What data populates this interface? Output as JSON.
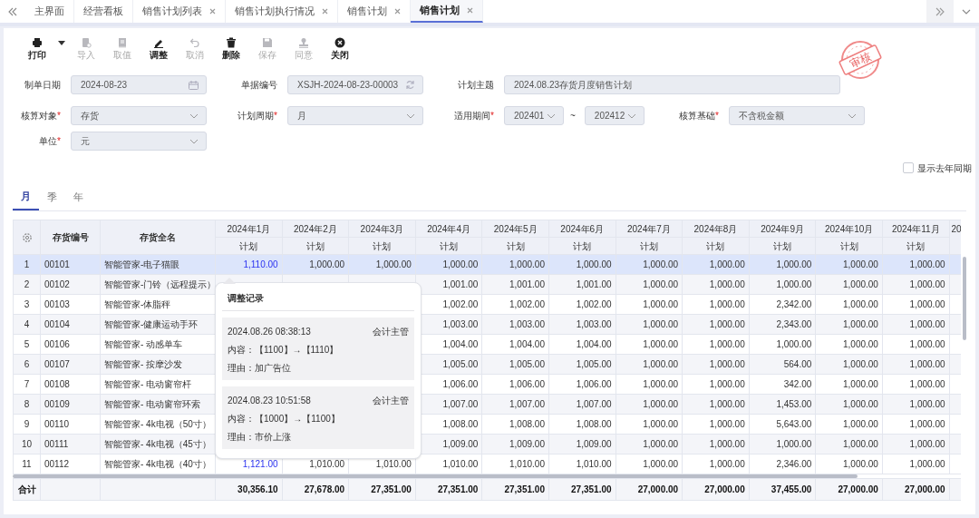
{
  "tab_bar": {
    "tabs": [
      {
        "label": "主界面",
        "closable": false,
        "selected": false
      },
      {
        "label": "经营看板",
        "closable": false,
        "selected": false
      },
      {
        "label": "销售计划列表",
        "closable": true,
        "selected": false
      },
      {
        "label": "销售计划执行情况",
        "closable": true,
        "selected": false
      },
      {
        "label": "销售计划",
        "closable": true,
        "selected": false
      },
      {
        "label": "销售计划",
        "closable": true,
        "selected": true
      }
    ]
  },
  "toolbar": [
    {
      "kind": "print",
      "label": "打印",
      "disabled": false,
      "dropdown": true
    },
    {
      "kind": "import",
      "label": "导入",
      "disabled": true,
      "dropdown": false
    },
    {
      "kind": "fetch",
      "label": "取值",
      "disabled": true,
      "dropdown": false
    },
    {
      "kind": "adjust",
      "label": "调整",
      "disabled": false,
      "dropdown": false
    },
    {
      "kind": "cancel",
      "label": "取消",
      "disabled": true,
      "dropdown": false
    },
    {
      "kind": "delete",
      "label": "删除",
      "disabled": false,
      "dropdown": false
    },
    {
      "kind": "save",
      "label": "保存",
      "disabled": true,
      "dropdown": false
    },
    {
      "kind": "approve",
      "label": "同意",
      "disabled": true,
      "dropdown": false
    },
    {
      "kind": "close",
      "label": "关闭",
      "disabled": false,
      "dropdown": false
    }
  ],
  "stamp": {
    "text": "审核"
  },
  "form": {
    "rows": [
      [
        {
          "kind": "date",
          "label": "制单日期",
          "value": "2024-08-23"
        },
        {
          "kind": "code",
          "label": "单据编号",
          "value": "XSJH-2024-08-23-00003"
        },
        {
          "kind": "text",
          "label": "计划主题",
          "value": "2024.08.23存货月度销售计划"
        }
      ],
      [
        {
          "kind": "select",
          "label": "核算对象",
          "required_mark": "*",
          "value": "存货"
        },
        {
          "kind": "select",
          "label": "计划周期",
          "required_mark": "*",
          "value": "月"
        },
        {
          "kind": "range",
          "label": "适用期间",
          "required_mark": "*",
          "from": "202401",
          "separator": "~",
          "to": "202412"
        },
        {
          "kind": "select",
          "label": "核算基础",
          "required_mark": "*",
          "value": "不含税金额"
        }
      ],
      [
        {
          "kind": "select",
          "label": "单位",
          "required_mark": "*",
          "value": "元"
        }
      ]
    ]
  },
  "show_last_year": {
    "label": "显示去年同期",
    "checked": false
  },
  "period_tabs": [
    {
      "label": "月",
      "selected": true
    },
    {
      "label": "季",
      "selected": false
    },
    {
      "label": "年",
      "selected": false
    }
  ],
  "table": {
    "columns": [
      {
        "label": "存货编号"
      },
      {
        "label": "存货全名"
      }
    ],
    "month_columns": [
      {
        "label": "2024年1月",
        "sub": "计划"
      },
      {
        "label": "2024年2月",
        "sub": "计划"
      },
      {
        "label": "2024年3月",
        "sub": "计划"
      },
      {
        "label": "2024年4月",
        "sub": "计划"
      },
      {
        "label": "2024年5月",
        "sub": "计划"
      },
      {
        "label": "2024年6月",
        "sub": "计划"
      },
      {
        "label": "2024年7月",
        "sub": "计划"
      },
      {
        "label": "2024年8月",
        "sub": "计划"
      },
      {
        "label": "2024年9月",
        "sub": "计划"
      },
      {
        "label": "2024年10月",
        "sub": "计划"
      },
      {
        "label": "2024年11月",
        "sub": "计划"
      },
      {
        "label": "20"
      }
    ],
    "rows": [
      {
        "index": "1",
        "code": "00101",
        "name": "智能管家-电子猫眼",
        "selected": true,
        "cells": [
          {
            "text": "1,110.00",
            "adjusted": true
          },
          "1,000.00",
          "1,000.00",
          "1,000.00",
          "1,000.00",
          "1,000.00",
          "1,000.00",
          "1,000.00",
          "1,000.00",
          "1,000.00",
          "1,000.00"
        ]
      },
      {
        "index": "2",
        "code": "00102",
        "name": "智能管家-门铃（远程提示）",
        "selected": false,
        "cells": [
          null,
          null,
          null,
          "1,001.00",
          "1,001.00",
          "1,001.00",
          "1,000.00",
          "1,000.00",
          "1,000.00",
          "1,000.00",
          "1,000.00"
        ]
      },
      {
        "index": "3",
        "code": "00103",
        "name": "智能管家-体脂秤",
        "selected": false,
        "cells": [
          null,
          null,
          null,
          "1,002.00",
          "1,002.00",
          "1,002.00",
          "1,000.00",
          "1,000.00",
          "2,342.00",
          "1,000.00",
          "1,000.00"
        ]
      },
      {
        "index": "4",
        "code": "00104",
        "name": "智能管家-健康运动手环",
        "selected": false,
        "cells": [
          null,
          null,
          null,
          "1,003.00",
          "1,003.00",
          "1,003.00",
          "1,000.00",
          "1,000.00",
          "2,343.00",
          "1,000.00",
          "1,000.00"
        ]
      },
      {
        "index": "5",
        "code": "00106",
        "name": "智能管家- 动感单车",
        "selected": false,
        "cells": [
          null,
          null,
          null,
          "1,004.00",
          "1,004.00",
          "1,004.00",
          "1,000.00",
          "1,000.00",
          "1,000.00",
          "1,000.00",
          "1,000.00"
        ]
      },
      {
        "index": "6",
        "code": "00107",
        "name": "智能管家- 按摩沙发",
        "selected": false,
        "cells": [
          null,
          null,
          null,
          "1,005.00",
          "1,005.00",
          "1,005.00",
          "1,000.00",
          "1,000.00",
          "564.00",
          "1,000.00",
          "1,000.00"
        ]
      },
      {
        "index": "7",
        "code": "00108",
        "name": "智能管家- 电动窗帘杆",
        "selected": false,
        "cells": [
          null,
          null,
          null,
          "1,006.00",
          "1,006.00",
          "1,006.00",
          "1,000.00",
          "1,000.00",
          "342.00",
          "1,000.00",
          "1,000.00"
        ]
      },
      {
        "index": "8",
        "code": "00109",
        "name": "智能管家- 电动窗帘环索",
        "selected": false,
        "cells": [
          null,
          null,
          null,
          "1,007.00",
          "1,007.00",
          "1,007.00",
          "1,000.00",
          "1,000.00",
          "1,453.00",
          "1,000.00",
          "1,000.00"
        ]
      },
      {
        "index": "9",
        "code": "00110",
        "name": "智能管家- 4k电视（50寸）",
        "selected": false,
        "cells": [
          null,
          null,
          null,
          "1,008.00",
          "1,008.00",
          "1,008.00",
          "1,000.00",
          "1,000.00",
          "5,643.00",
          "1,000.00",
          "1,000.00"
        ]
      },
      {
        "index": "10",
        "code": "00111",
        "name": "智能管家- 4k电视（45寸）",
        "selected": false,
        "cells": [
          null,
          null,
          null,
          "1,009.00",
          "1,009.00",
          "1,009.00",
          "1,000.00",
          "1,000.00",
          "1,000.00",
          "1,000.00",
          "1,000.00"
        ]
      },
      {
        "index": "11",
        "code": "00112",
        "name": "智能管家- 4k电视（40寸）",
        "selected": false,
        "cells": [
          {
            "text": "1,121.00",
            "adjusted": true
          },
          "1,010.00",
          "1,010.00",
          "1,010.00",
          "1,010.00",
          "1,010.00",
          "1,000.00",
          "1,000.00",
          "2,346.00",
          "1,000.00",
          "1,000.00"
        ]
      }
    ],
    "total": {
      "label": "合计",
      "cells": [
        "30,356.10",
        "27,678.00",
        "27,351.00",
        "27,351.00",
        "27,351.00",
        "27,351.00",
        "27,000.00",
        "27,000.00",
        "37,455.00",
        "27,000.00",
        "27,000.00"
      ]
    }
  },
  "popover": {
    "title": "调整记录",
    "records": [
      {
        "time": "2024.08.26 08:38:13",
        "user": "会计主管",
        "content": "内容：【1100】→【1110】",
        "reason": "理由：加广告位"
      },
      {
        "time": "2024.08.23 10:51:58",
        "user": "会计主管",
        "content": "内容：【1000】→【1100】",
        "reason": "理由：市价上涨"
      }
    ]
  }
}
